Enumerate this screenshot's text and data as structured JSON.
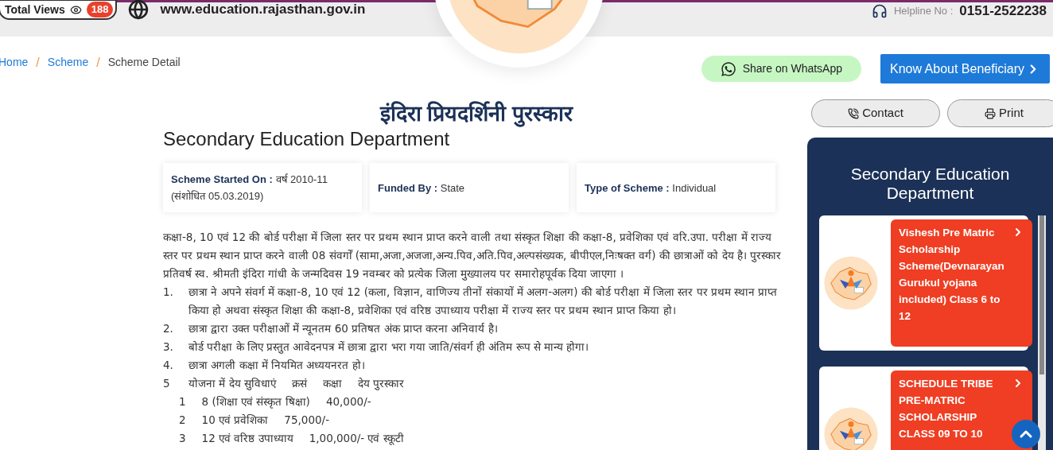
{
  "header": {
    "views_label": "Total Views",
    "views_count": "188",
    "website": "www.education.rajasthan.gov.in",
    "helpline_label": "Helpline No :",
    "helpline_number": "0151-2522238"
  },
  "breadcrumb_separator": "/",
  "breadcrumbs": [
    {
      "label": "Home",
      "current": false
    },
    {
      "label": "Scheme",
      "current": false
    },
    {
      "label": "Scheme Detail",
      "current": true
    }
  ],
  "actions": {
    "whatsapp": "Share on WhatsApp",
    "beneficiary": "Know About Beneficiary"
  },
  "title": "इंदिरा प्रियदर्शिनी पुरस्कार",
  "department": "Secondary Education Department",
  "info_cards": [
    {
      "label": "Scheme Started On :",
      "value": "वर्ष 2010-11 (संशोधित 05.03.2019)"
    },
    {
      "label": "Funded By :",
      "value": "State"
    },
    {
      "label": "Type of Scheme :",
      "value": "Individual"
    }
  ],
  "description": [
    {
      "kind": "paragraph",
      "text": "कक्षा-8, 10 एवं 12 की बोर्ड परीक्षा में जिला स्तर पर प्रथम स्थान प्राप्त करने वाली तथा संस्कृत शिक्षा की कक्षा-8, प्रवेशिका एवं वरि.उपा. परीक्षा में राज्य स्तर पर प्रथम स्थान प्राप्त करने वाली 08 संवर्गों (सामा,अजा,अजजा,अन्य.पिव,अति.पिव,अल्पसंख्यक, बीपीएल,निःषक्त वर्ग) की  छात्राओं को देय है। पुरस्कार प्रतिवर्ष स्व. श्रीमती इंदिरा गांधी के जन्मदिवस 19 नवम्बर को प्रत्येक जिला मुख्यालय पर समारोहपूर्वक दिया जाएगा ।"
    },
    {
      "kind": "numbered",
      "marker": "1.",
      "text": "छात्रा ने अपने संवर्ग में कक्षा-8, 10 एवं 12 (कला, विज्ञान, वाणिज्य तीनों संकायों में अलग-अलग) की बोर्ड परीक्षा में जिला स्तर पर प्रथम स्थान प्राप्त किया हो अथवा संस्कृत शिक्षा की कक्षा-8, प्रवेशिका एवं वरिष्ठ उपाध्याय परीक्षा में राज्य स्तर पर प्रथम स्थान प्राप्त किया हो।"
    },
    {
      "kind": "numbered",
      "marker": "2.",
      "text": "छात्रा द्वारा उक्त परीक्षाओं में न्यूनतम 60 प्रतिषत अंक प्राप्त करना अनिवार्य है।"
    },
    {
      "kind": "numbered",
      "marker": "3.",
      "text": "बोर्ड परीक्षा के लिए प्रस्तुत आवेदनपत्र में छात्रा द्वारा भरा गया जाति/संवर्ग ही अंतिम रूप से मान्य होगा।"
    },
    {
      "kind": "numbered",
      "marker": "4.",
      "text": "छात्रा अगली कक्षा में नियमित अध्ययनरत हो।"
    },
    {
      "kind": "row",
      "marker": "5",
      "cells": [
        "योजना में देय सुविधाएं",
        "क्रसं",
        "कक्षा",
        "देय पुरस्कार"
      ]
    },
    {
      "kind": "subrow",
      "marker": "1",
      "cells": [
        "8 (शिक्षा एवं संस्कृत षिक्षा)",
        "40,000/-"
      ]
    },
    {
      "kind": "subrow",
      "marker": "2",
      "cells": [
        "10 एवं प्रवेशिका",
        "75,000/-"
      ]
    },
    {
      "kind": "subrow",
      "marker": "3",
      "cells": [
        "12 एवं वरिष्ठ उपाध्याय",
        "1,00,000/- एवं स्कूटी"
      ]
    }
  ],
  "sidebar": {
    "buttons": [
      {
        "kind": "contact",
        "label": "Contact"
      },
      {
        "kind": "print",
        "label": "Print"
      }
    ],
    "title": "Secondary Education Department",
    "schemes": [
      "Vishesh Pre Matric Scholarship Scheme(Devnarayan Gurukul yojana included) Class 6 to 12",
      "SCHEDULE TRIBE PRE-MATRIC SCHOLARSHIP CLASS 09 TO 10"
    ]
  }
}
